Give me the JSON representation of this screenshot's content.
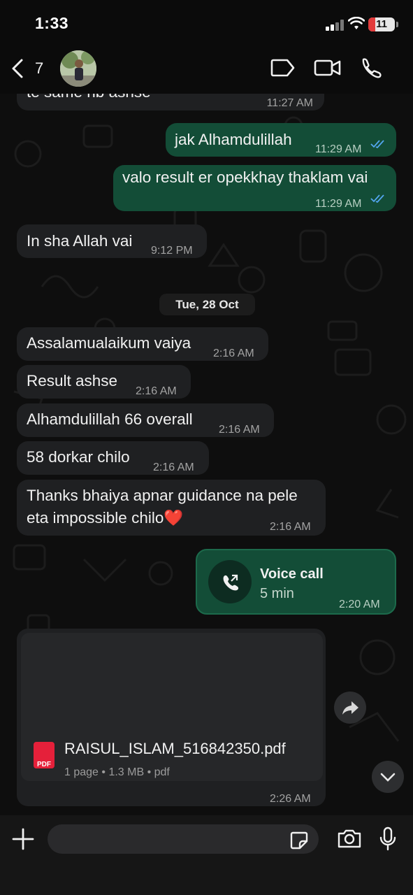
{
  "status_bar": {
    "time": "1:33",
    "battery": "11",
    "battery_level_percent": 11
  },
  "header": {
    "back_count": "7"
  },
  "messages": [
    {
      "dir": "in",
      "text": "te same hb ashse",
      "time": "11:27 AM"
    },
    {
      "dir": "out",
      "text": "jak Alhamdulillah",
      "time": "11:29 AM",
      "status": "read"
    },
    {
      "dir": "out",
      "text": "valo result er opekkhay thaklam vai",
      "time": "11:29 AM",
      "status": "read"
    },
    {
      "dir": "in",
      "text": "In sha Allah vai",
      "time": "9:12 PM"
    },
    {
      "dir": "in",
      "text": "Assalamualaikum vaiya",
      "time": "2:16 AM"
    },
    {
      "dir": "in",
      "text": "Result ashse",
      "time": "2:16 AM"
    },
    {
      "dir": "in",
      "text": "Alhamdulillah 66 overall",
      "time": "2:16 AM"
    },
    {
      "dir": "in",
      "text": "58 dorkar chilo",
      "time": "2:16 AM"
    },
    {
      "dir": "in",
      "lines": [
        "Thanks bhaiya apnar guidance na pele",
        "eta impossible chilo"
      ],
      "emoji": "❤️",
      "time": "2:16 AM"
    }
  ],
  "date_separator": "Tue, 28 Oct",
  "voice_call": {
    "title": "Voice call",
    "duration": "5 min",
    "time": "2:20 AM"
  },
  "document": {
    "filename": "RAISUL_ISLAM_516842350.pdf",
    "pages": "1 page",
    "size": "1.3 MB",
    "type": "pdf",
    "badge": "PDF",
    "time": "2:26 AM"
  },
  "composer": {
    "placeholder": ""
  },
  "colors": {
    "incoming": "#1f2022",
    "outgoing": "#134d37",
    "read_ticks": "#53a6f0",
    "pdf": "#e5203a"
  },
  "icons": [
    "back-chevron-icon",
    "tag-icon",
    "video-call-icon",
    "phone-icon",
    "call-out-icon",
    "forward-icon",
    "scroll-down-icon",
    "plus-icon",
    "sticker-icon",
    "camera-icon",
    "mic-icon"
  ]
}
